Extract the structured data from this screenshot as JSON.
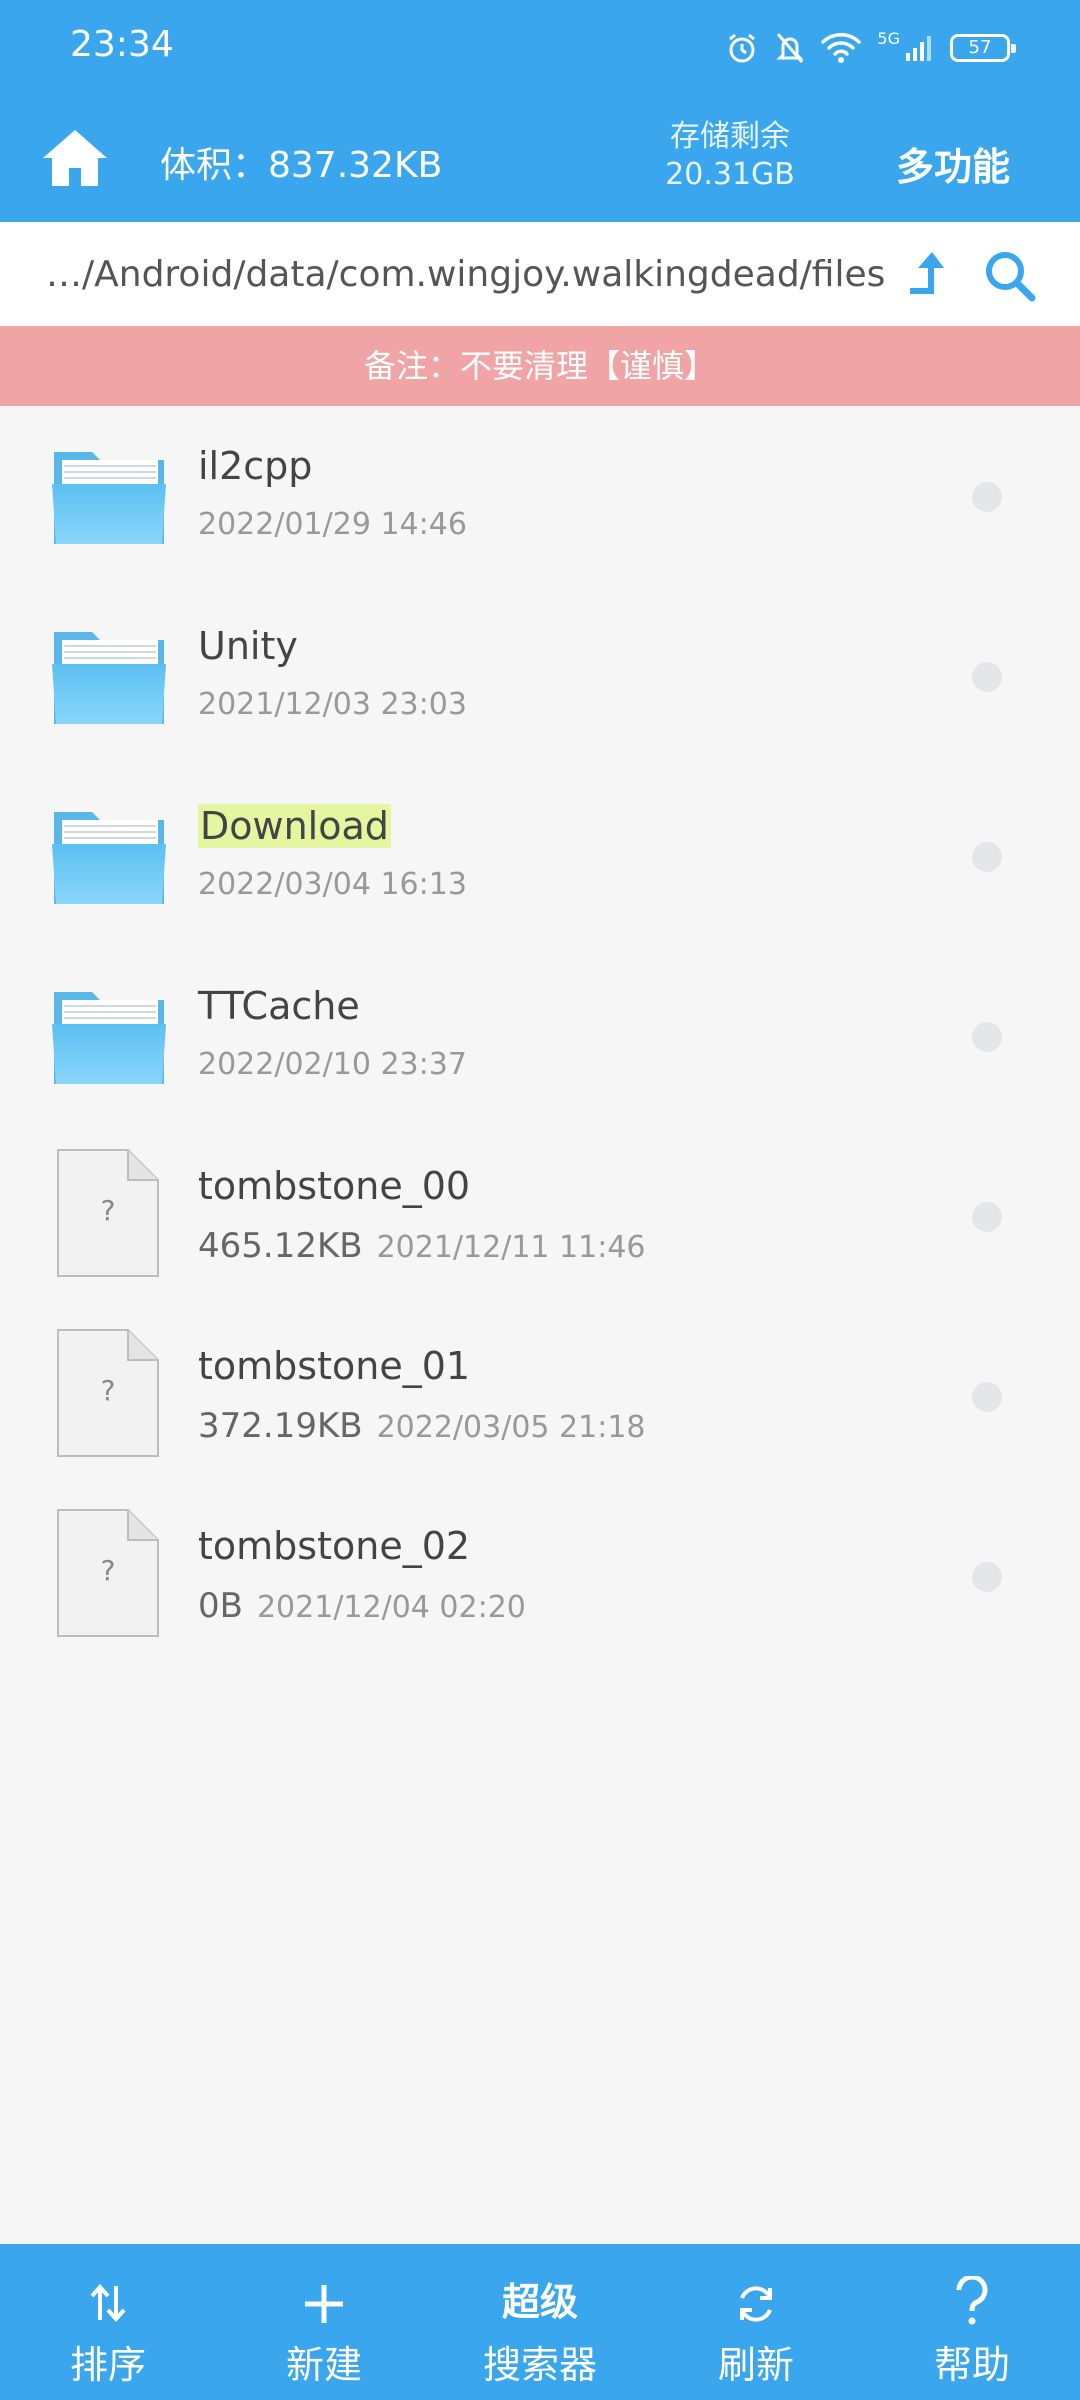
{
  "status_bar": {
    "time": "23:34",
    "network": "5G",
    "battery": "57"
  },
  "app_bar": {
    "size_label": "体积：837.32KB",
    "storage_label": "存储剩余",
    "storage_value": "20.31GB",
    "multi_function": "多功能"
  },
  "path_bar": {
    "path": "…/Android/data/com.wingjoy.walkingdead/files"
  },
  "note": "备注：不要清理【谨慎】",
  "files": [
    {
      "name": "il2cpp",
      "type": "folder",
      "size": "",
      "date": "2022/01/29 14:46"
    },
    {
      "name": "Unity",
      "type": "folder",
      "size": "",
      "date": "2021/12/03 23:03"
    },
    {
      "name": "Download",
      "type": "folder",
      "size": "",
      "date": "2022/03/04 16:13",
      "highlighted": true
    },
    {
      "name": "TTCache",
      "type": "folder",
      "size": "",
      "date": "2022/02/10 23:37"
    },
    {
      "name": "tombstone_00",
      "type": "file",
      "size": "465.12KB",
      "date": "2021/12/11 11:46"
    },
    {
      "name": "tombstone_01",
      "type": "file",
      "size": "372.19KB",
      "date": "2022/03/05 21:18"
    },
    {
      "name": "tombstone_02",
      "type": "file",
      "size": "0B",
      "date": "2021/12/04 02:20"
    }
  ],
  "unknown_file_glyph": "?",
  "bottom_bar": {
    "sort": "排序",
    "new": "新建",
    "super_top": "超级",
    "super_bottom": "搜索器",
    "refresh": "刷新",
    "help": "帮助"
  },
  "colors": {
    "primary": "#3aa6ee",
    "note_bg": "#f1a4a6",
    "highlight": "#e6f5a0",
    "folder": "#5cc0f2"
  }
}
